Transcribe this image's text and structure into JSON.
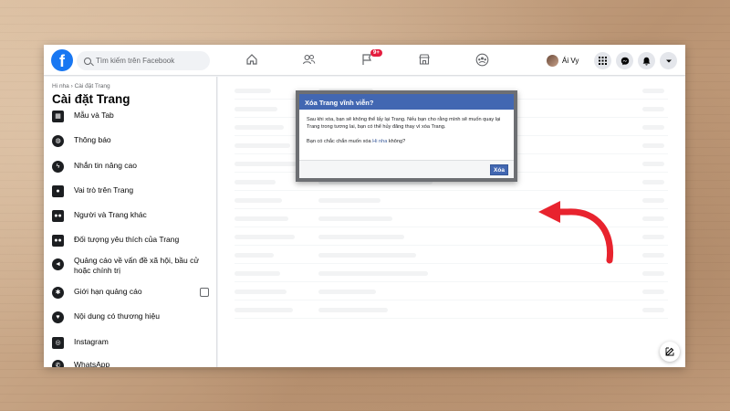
{
  "topbar": {
    "logo": "f",
    "search_placeholder": "Tìm kiếm trên Facebook",
    "nav_icons": [
      "home-icon",
      "friends-icon",
      "flag-icon",
      "marketplace-icon",
      "groups-icon"
    ],
    "notification_badge": "9+",
    "user_name": "Ái Vy"
  },
  "sidebar": {
    "breadcrumb": "Hi nha › Cài đặt Trang",
    "title": "Cài đặt Trang",
    "items": [
      {
        "label": "Mẫu và Tab",
        "icon": "grid-icon"
      },
      {
        "label": "Thông báo",
        "icon": "globe-icon"
      },
      {
        "label": "Nhắn tin nâng cao",
        "icon": "messenger-icon"
      },
      {
        "label": "Vai trò trên Trang",
        "icon": "person-icon"
      },
      {
        "label": "Người và Trang khác",
        "icon": "people-icon"
      },
      {
        "label": "Đối tượng yêu thích của Trang",
        "icon": "audience-icon"
      },
      {
        "label": "Quảng cáo về vấn đề xã hội, bầu cử hoặc chính trị",
        "icon": "megaphone-icon"
      },
      {
        "label": "Giới hạn quảng cáo",
        "icon": "gear-icon"
      },
      {
        "label": "Nội dung có thương hiệu",
        "icon": "handshake-icon"
      },
      {
        "label": "Instagram",
        "icon": "instagram-icon"
      },
      {
        "label": "WhatsApp",
        "icon": "whatsapp-icon"
      }
    ]
  },
  "dialog": {
    "title": "Xóa Trang vĩnh viễn?",
    "body_1": "Sau khi xóa, bạn sẽ không thể lấy lại Trang. Nếu bạn cho rằng mình sẽ muốn quay lại Trang trong tương lai, bạn có thể hủy đăng thay vì xóa Trang.",
    "body_2_prefix": "Bạn có chắc chắn muốn xóa ",
    "body_2_link": "Hi nha",
    "body_2_suffix": " không?",
    "delete_label": "Xóa"
  },
  "colors": {
    "facebook_blue": "#1877f2",
    "dialog_header": "#4267b2",
    "arrow_red": "#e8232e",
    "badge_red": "#e41e3f"
  }
}
